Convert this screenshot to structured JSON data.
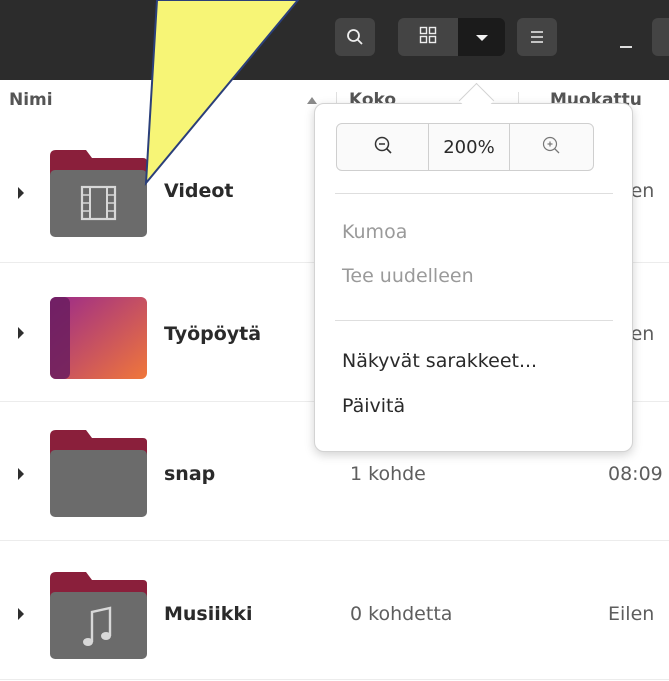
{
  "header": {
    "search_icon": "search-icon",
    "grid_icon": "grid-view-icon",
    "dropdown_icon": "chevron-down-icon",
    "menu_icon": "hamburger-menu-icon"
  },
  "columns": {
    "name": "Nimi",
    "size": "Koko",
    "modified": "Muokattu"
  },
  "rows": [
    {
      "name": "Videot",
      "size": "",
      "modified": "Eilen",
      "icon": "video-folder-icon"
    },
    {
      "name": "Työpöytä",
      "size": "",
      "modified": "Eilen",
      "icon": "desktop-folder-icon"
    },
    {
      "name": "snap",
      "size": "1 kohde",
      "modified": "08:09",
      "icon": "folder-icon"
    },
    {
      "name": "Musiikki",
      "size": "0 kohdetta",
      "modified": "Eilen",
      "icon": "music-folder-icon"
    }
  ],
  "popover": {
    "zoom_level": "200%",
    "zoom_out_icon": "zoom-out-icon",
    "zoom_in_icon": "zoom-in-icon",
    "undo": "Kumoa",
    "redo": "Tee uudelleen",
    "visible_columns": "Näkyvät sarakkeet...",
    "refresh": "Päivitä"
  },
  "colors": {
    "headerbar": "#2c2c2c",
    "folder_body": "#6b6b6b",
    "folder_tab": "#8a1f3b",
    "desktop_gradient_start": "#9b2a8a",
    "desktop_gradient_end": "#f0773a",
    "callout": "#f7f576"
  }
}
